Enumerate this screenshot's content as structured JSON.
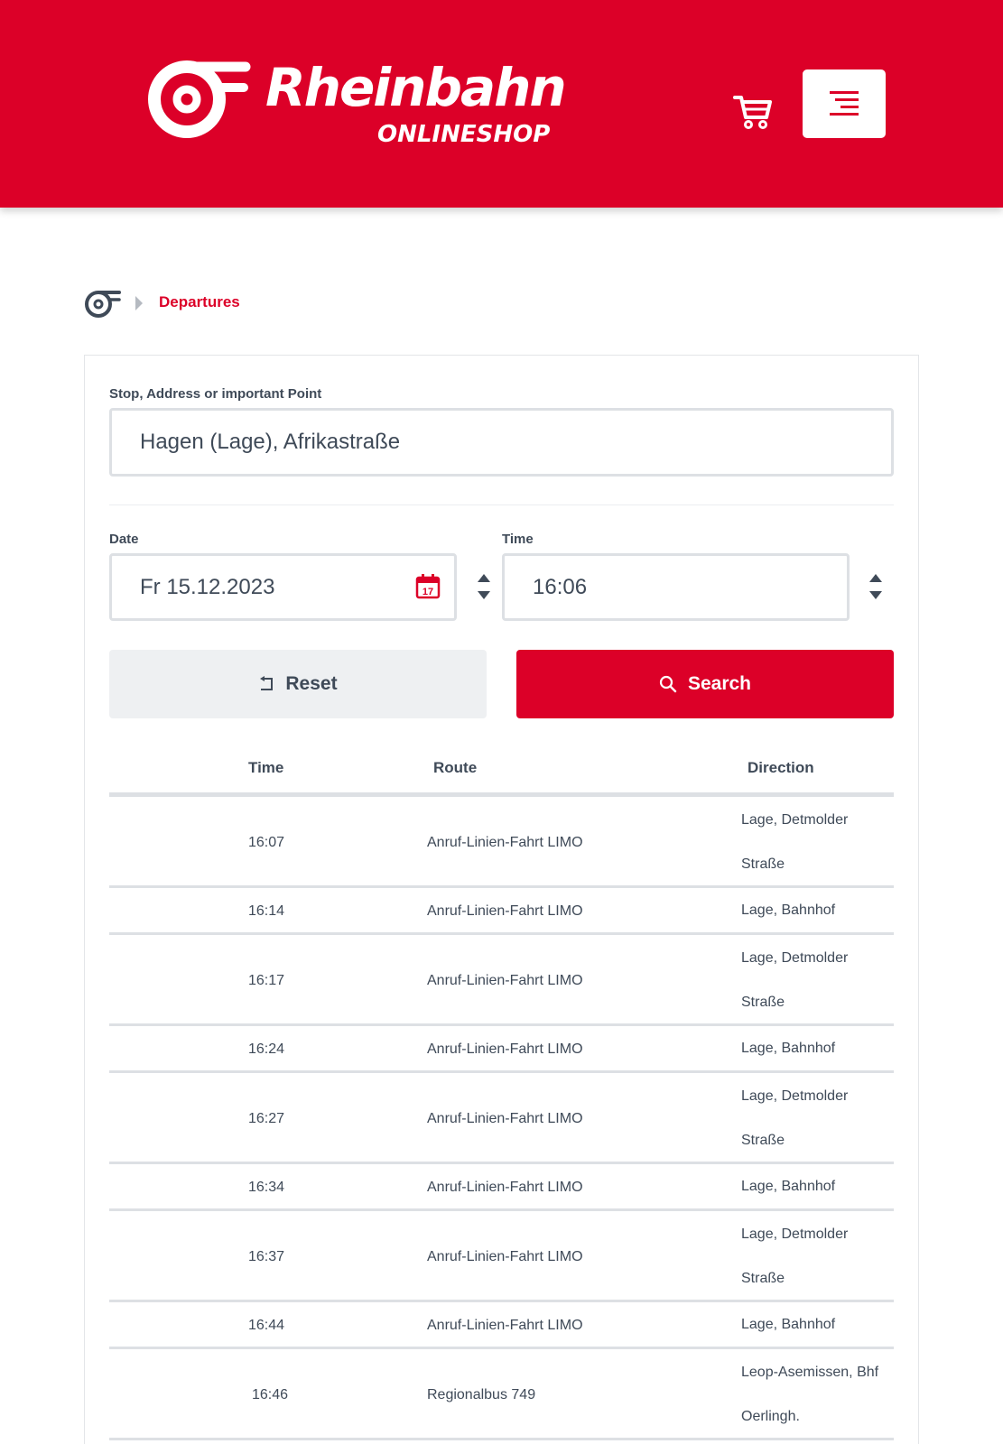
{
  "header": {
    "brand_name": "Rheinbahn",
    "brand_sub": "ONLINESHOP",
    "brand_color": "#dc0028",
    "cart_icon": "cart-icon",
    "menu_icon": "menu-icon"
  },
  "breadcrumb": {
    "home_icon": "rheinbahn-logo-icon",
    "current": "Departures"
  },
  "form": {
    "stop_label": "Stop, Address or important Point",
    "stop_value": "Hagen (Lage), Afrikastraße",
    "date_label": "Date",
    "date_value": "Fr 15.12.2023",
    "calendar_day": "17",
    "time_label": "Time",
    "time_value": "16:06",
    "reset_label": "Reset",
    "search_label": "Search"
  },
  "table": {
    "columns": [
      "Time",
      "Route",
      "Direction"
    ],
    "rows": [
      {
        "time": "16:07",
        "route": "Anruf-Linien-Fahrt LIMO",
        "direction": "Lage, Detmolder Straße"
      },
      {
        "time": "16:14",
        "route": "Anruf-Linien-Fahrt LIMO",
        "direction": "Lage, Bahnhof"
      },
      {
        "time": "16:17",
        "route": "Anruf-Linien-Fahrt LIMO",
        "direction": "Lage, Detmolder Straße"
      },
      {
        "time": "16:24",
        "route": "Anruf-Linien-Fahrt LIMO",
        "direction": "Lage, Bahnhof"
      },
      {
        "time": "16:27",
        "route": "Anruf-Linien-Fahrt LIMO",
        "direction": "Lage, Detmolder Straße"
      },
      {
        "time": "16:34",
        "route": "Anruf-Linien-Fahrt LIMO",
        "direction": "Lage, Bahnhof"
      },
      {
        "time": "16:37",
        "route": "Anruf-Linien-Fahrt LIMO",
        "direction": "Lage, Detmolder Straße"
      },
      {
        "time": "16:44",
        "route": "Anruf-Linien-Fahrt LIMO",
        "direction": "Lage, Bahnhof"
      },
      {
        "time": "16:46",
        "route": "Regionalbus 749",
        "direction": "Leop-Asemissen, Bhf Oerlingh."
      }
    ]
  }
}
